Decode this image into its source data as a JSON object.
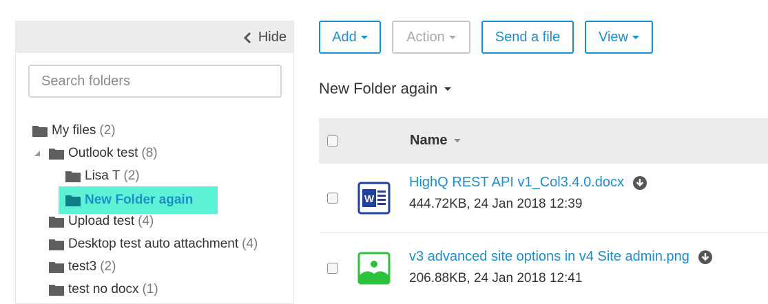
{
  "sidebar": {
    "hide_label": "Hide",
    "search_placeholder": "Search folders",
    "tree": [
      {
        "name": "My files",
        "count": "(2)"
      },
      {
        "name": "Outlook test",
        "count": "(8)"
      },
      {
        "name": "Lisa T",
        "count": "(2)"
      },
      {
        "name": "New Folder again",
        "count": "",
        "selected": true
      },
      {
        "name": "Upload test",
        "count": "(4)"
      },
      {
        "name": "Desktop test auto attachment",
        "count": "(4)"
      },
      {
        "name": "test3",
        "count": "(2)"
      },
      {
        "name": "test no docx",
        "count": "(1)"
      }
    ]
  },
  "toolbar": {
    "add_label": "Add",
    "action_label": "Action",
    "send_label": "Send a file",
    "view_label": "View"
  },
  "main": {
    "folder_title": "New Folder again",
    "table": {
      "name_header": "Name",
      "rows": [
        {
          "file_name": "HighQ REST API v1_Col3.4.0.docx",
          "meta": "444.72KB, 24 Jan 2018 12:39",
          "icon": "word-document-icon"
        },
        {
          "file_name": "v3 advanced site options in v4 Site admin.png",
          "meta": "206.88KB, 24 Jan 2018 12:41",
          "icon": "image-file-icon"
        }
      ]
    }
  },
  "colors": {
    "accent": "#1a8fcf",
    "selected_bg": "#5df2d6",
    "word_blue": "#1f3f9f",
    "image_green": "#2cc23c"
  }
}
